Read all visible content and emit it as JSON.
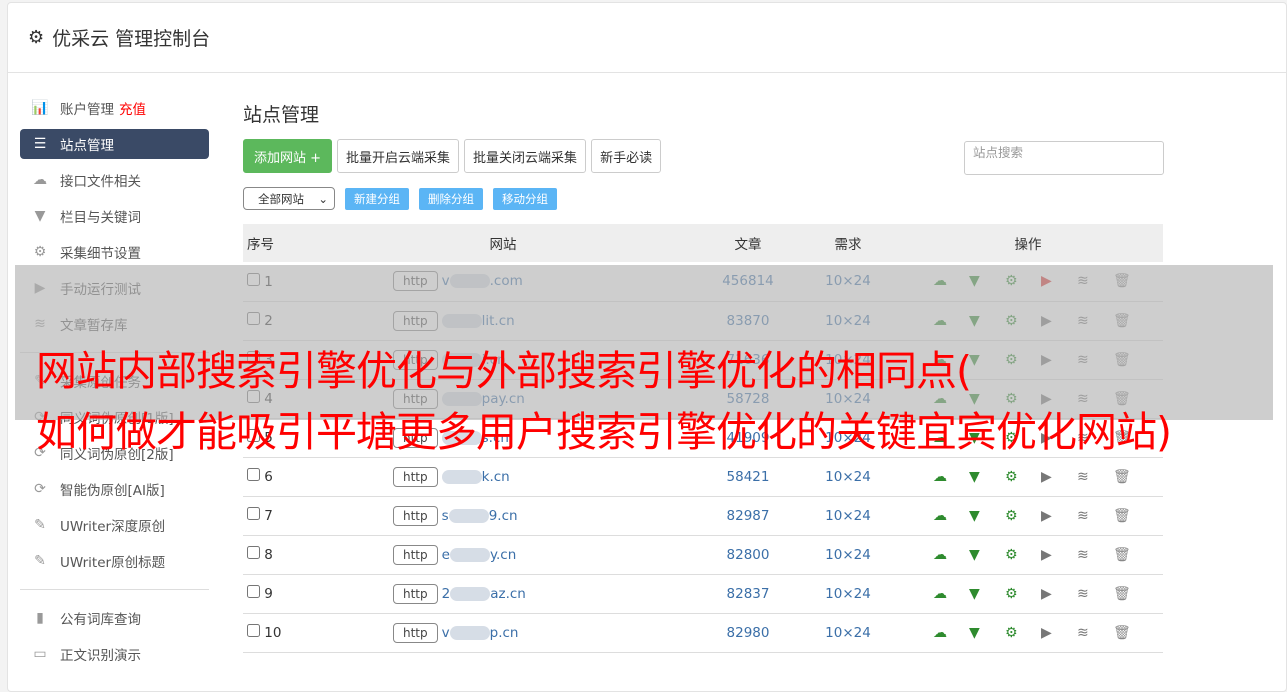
{
  "header": {
    "title": "优采云 管理控制台"
  },
  "sidebar": {
    "items": [
      {
        "label": "账户管理",
        "extra": "充值",
        "icon": "bar-chart-icon"
      },
      {
        "label": "站点管理",
        "icon": "server-icon",
        "active": true
      },
      {
        "label": "接口文件相关",
        "icon": "cloud-upload-icon"
      },
      {
        "label": "栏目与关键词",
        "icon": "filter-icon"
      },
      {
        "label": "采集细节设置",
        "icon": "gears-icon"
      },
      {
        "label": "手动运行测试",
        "icon": "play-icon"
      },
      {
        "label": "文章暂存库",
        "icon": "database-icon"
      },
      {
        "label": "采集原创任务",
        "icon": "edit-icon"
      },
      {
        "label": "同义词伪原创[1版]",
        "icon": "refresh-icon"
      },
      {
        "label": "同义词伪原创[2版]",
        "icon": "refresh-icon"
      },
      {
        "label": "智能伪原创[AI版]",
        "icon": "refresh-icon"
      },
      {
        "label": "UWriter深度原创",
        "icon": "edit-icon"
      },
      {
        "label": "UWriter原创标题",
        "icon": "edit-icon"
      },
      {
        "label": "公有词库查询",
        "icon": "book-icon"
      },
      {
        "label": "正文识别演示",
        "icon": "monitor-icon"
      }
    ]
  },
  "main": {
    "title": "站点管理",
    "buttons": {
      "add": "添加网站 +",
      "open": "批量开启云端采集",
      "close": "批量关闭云端采集",
      "guide": "新手必读"
    },
    "search_placeholder": "站点搜索",
    "filter": "全部网站",
    "group_buttons": [
      "新建分组",
      "删除分组",
      "移动分组"
    ],
    "columns": [
      "序号",
      "网站",
      "文章",
      "需求",
      "操作"
    ],
    "rows": [
      {
        "id": "1",
        "proto": "http",
        "pre": "v",
        "url": ".com",
        "articles": "456814",
        "need": "10×24",
        "run_active": true
      },
      {
        "id": "2",
        "proto": "http",
        "pre": "",
        "url": "lit.cn",
        "articles": "83870",
        "need": "10×24"
      },
      {
        "id": "3",
        "proto": "http",
        "pre": "",
        "url": "i.cn",
        "articles": "71636",
        "need": "10×24"
      },
      {
        "id": "4",
        "proto": "http",
        "pre": "",
        "url": "pay.cn",
        "articles": "58728",
        "need": "10×24"
      },
      {
        "id": "5",
        "proto": "http",
        "pre": "",
        "url": "s.cn",
        "articles": "41909",
        "need": "10×24"
      },
      {
        "id": "6",
        "proto": "http",
        "pre": "",
        "url": "k.cn",
        "articles": "58421",
        "need": "10×24"
      },
      {
        "id": "7",
        "proto": "http",
        "pre": "s",
        "url": "9.cn",
        "articles": "82987",
        "need": "10×24"
      },
      {
        "id": "8",
        "proto": "http",
        "pre": "e",
        "url": "y.cn",
        "articles": "82800",
        "need": "10×24"
      },
      {
        "id": "9",
        "proto": "http",
        "pre": "2",
        "url": "az.cn",
        "articles": "82837",
        "need": "10×24"
      },
      {
        "id": "10",
        "proto": "http",
        "pre": "v",
        "url": "p.cn",
        "articles": "82980",
        "need": "10×24"
      }
    ]
  },
  "overlay": {
    "line1": "网站内部搜索引擎优化与外部搜索引擎优化的相同点(",
    "line2": "如何做才能吸引平塘更多用户搜索引擎优化的关键宜宾优化网站)"
  },
  "colors": {
    "accent": "#3a4a66",
    "green": "#5cb85c",
    "blue_btn": "#5bb5f5",
    "overlay_text": "#ff0000"
  }
}
